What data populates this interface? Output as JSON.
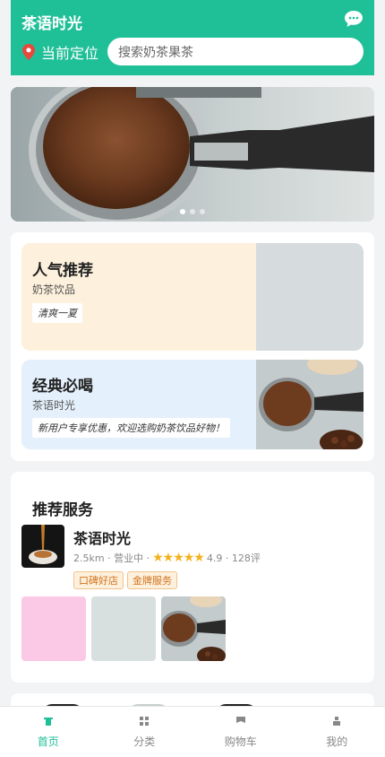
{
  "header": {
    "title": "茶语时光",
    "location_label": "当前定位",
    "search_placeholder": "搜索奶茶果茶",
    "brand_color": "#1fbf98",
    "message_icon": "chat-bubble-icon",
    "location_icon": "pin-icon"
  },
  "banner": {
    "image": "coffee-portafilter-photo",
    "dots": 3,
    "active_dot": 1
  },
  "cards": [
    {
      "title": "人气推荐",
      "subtitle": "奶茶饮品",
      "tag": "清爽一夏",
      "bg": "#fdf0dc"
    },
    {
      "title": "经典必喝",
      "subtitle": "茶语时光",
      "tag": "新用户专享优惠，欢迎选购奶茶饮品好物！",
      "bg": "#e4f0fb"
    }
  ],
  "services": {
    "heading": "推荐服务",
    "shop": {
      "name": "茶语时光",
      "distance": "2.5km",
      "status": "营业中",
      "stars": "★★★★★",
      "rating": "4.9",
      "reviews": "128评",
      "badges": [
        "口碑好店",
        "金牌服务"
      ]
    }
  },
  "tabs": [
    {
      "label": "首页",
      "icon": "home-icon",
      "active": true
    },
    {
      "label": "分类",
      "icon": "grid-icon",
      "active": false
    },
    {
      "label": "购物车",
      "icon": "cart-icon",
      "active": false
    },
    {
      "label": "我的",
      "icon": "user-icon",
      "active": false
    }
  ]
}
